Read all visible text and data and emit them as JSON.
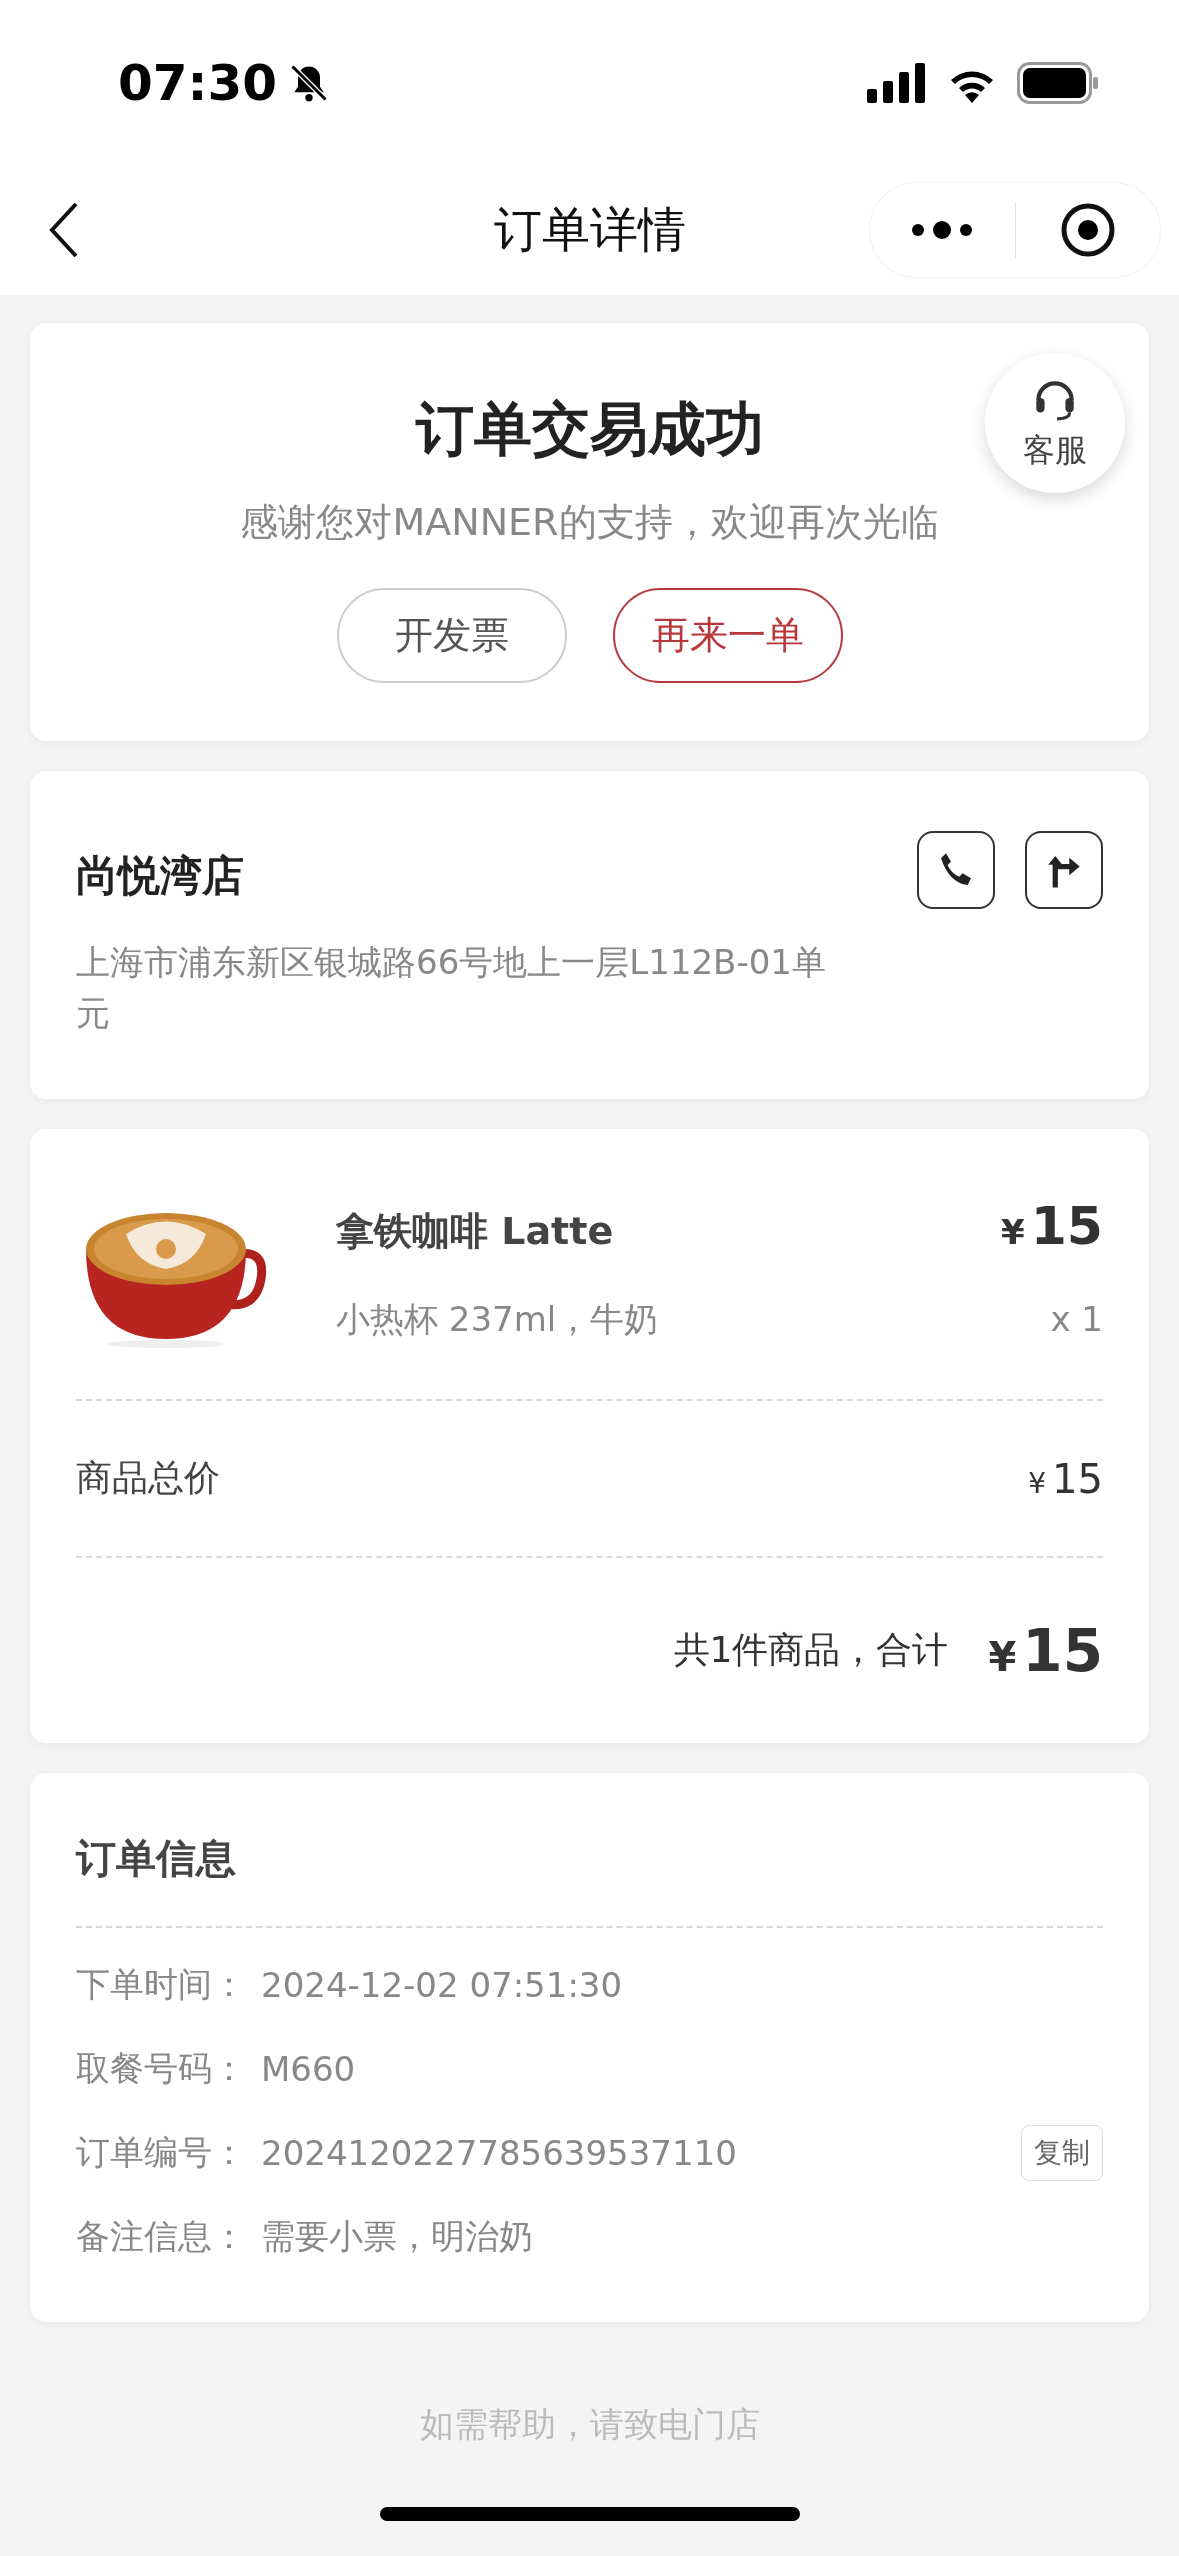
{
  "status_bar": {
    "time": "07:30"
  },
  "nav": {
    "title": "订单详情"
  },
  "result": {
    "title": "订单交易成功",
    "message": "感谢您对MANNER的支持，欢迎再次光临",
    "service_label": "客服",
    "buttons": [
      {
        "label": "开发票",
        "kind": "outline"
      },
      {
        "label": "再来一单",
        "kind": "primary"
      }
    ]
  },
  "store": {
    "name": "尚悦湾店",
    "address": "上海市浦东新区银城路66号地上一层L112B-01单元"
  },
  "items": [
    {
      "kind": "picture",
      "name": "拿铁咖啡 Latte",
      "spec": "小热杯 237ml，牛奶",
      "currency": "¥",
      "price": "15",
      "quantity": "x 1"
    }
  ],
  "subtotal": {
    "label": "商品总价",
    "currency": "¥",
    "value": "15"
  },
  "total": {
    "label": "共1件商品，合计",
    "currency": "¥",
    "value": "15"
  },
  "order_info": {
    "title": "订单信息",
    "rows": [
      {
        "label": "下单时间：",
        "value": "2024-12-02 07:51:30"
      },
      {
        "label": "取餐号码：",
        "value": "M660"
      },
      {
        "label": "订单编号：",
        "value": "2024120227785639537110",
        "action": "复制"
      },
      {
        "label": "备注信息：",
        "value": "需要小票，明治奶"
      }
    ]
  },
  "footer": {
    "text": "如需帮助，请致电门店"
  }
}
